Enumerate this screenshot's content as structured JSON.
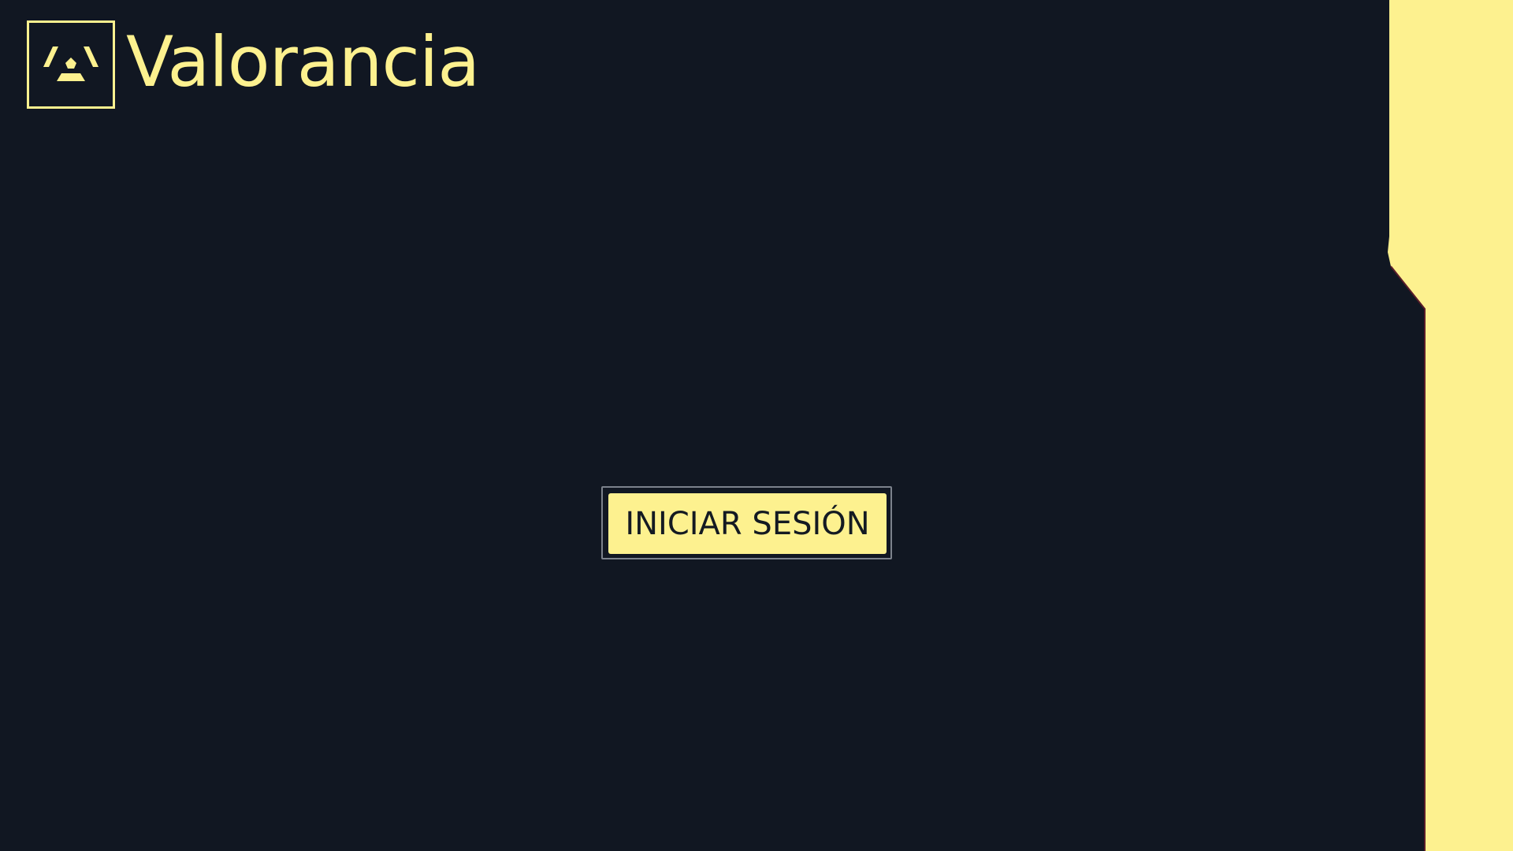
{
  "app": {
    "title": "Valorancia",
    "logo_icon": "valorancia-logo-icon"
  },
  "login": {
    "button_label": "INICIAR SESIÓN"
  },
  "colors": {
    "background": "#111722",
    "accent": "#fdf18f",
    "button_text": "#141a22",
    "button_frame": "#7c828c"
  }
}
